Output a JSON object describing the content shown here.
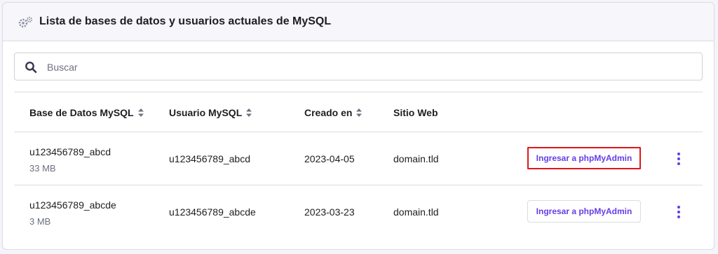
{
  "header": {
    "title": "Lista de bases de datos y usuarios actuales de MySQL",
    "icon": "gears-icon"
  },
  "search": {
    "placeholder": "Buscar",
    "value": ""
  },
  "table": {
    "columns": [
      {
        "label": "Base de Datos MySQL",
        "sortable": true
      },
      {
        "label": "Usuario MySQL",
        "sortable": true
      },
      {
        "label": "Creado en",
        "sortable": true
      },
      {
        "label": "Sitio Web",
        "sortable": false
      }
    ],
    "rows": [
      {
        "database": "u123456789_abcd",
        "size": "33 MB",
        "user": "u123456789_abcd",
        "created": "2023-04-05",
        "site": "domain.tld",
        "action": "Ingresar a phpMyAdmin",
        "highlighted": true
      },
      {
        "database": "u123456789_abcde",
        "size": "3 MB",
        "user": "u123456789_abcde",
        "created": "2023-03-23",
        "site": "domain.tld",
        "action": "Ingresar a phpMyAdmin",
        "highlighted": false
      }
    ]
  },
  "colors": {
    "accent": "#673de6",
    "highlight": "#e0161b",
    "text": "#1d1e20",
    "muted": "#6d7081"
  }
}
